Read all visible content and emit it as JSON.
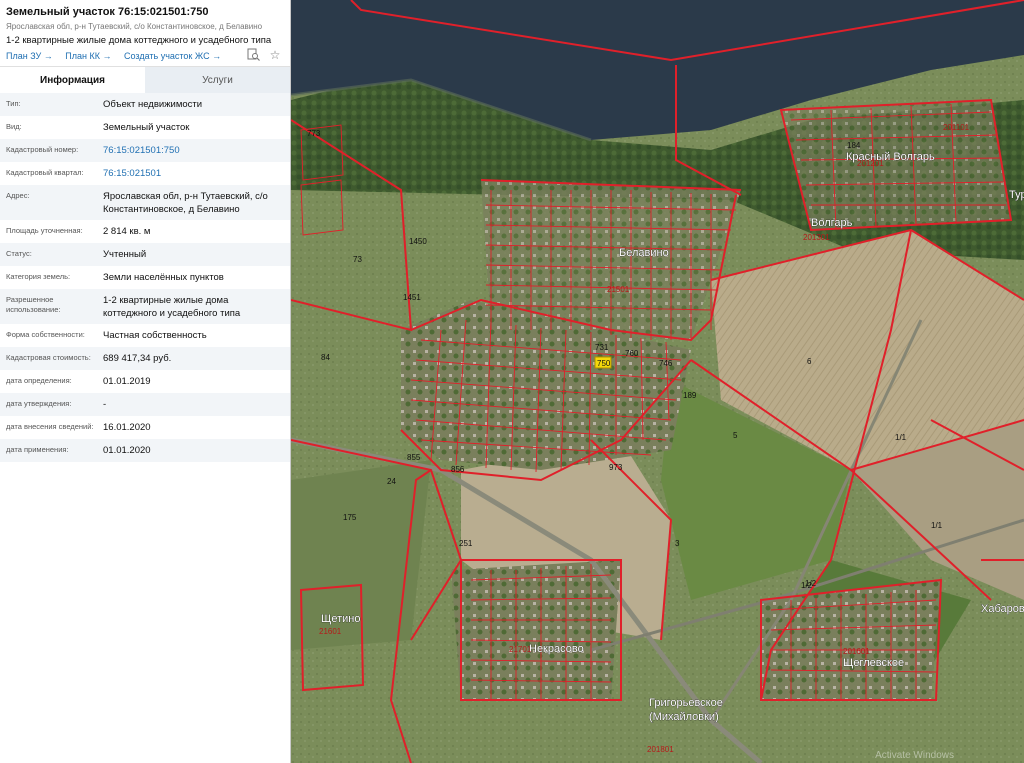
{
  "header": {
    "title": "Земельный участок 76:15:021501:750",
    "address_short": "Ярославская обл, р-н Тутаевский, с/о Константиновское, д Белавино",
    "permitted_use": "1-2 квартирные жилые дома коттеджного и усадебного типа",
    "links": [
      "План ЗУ",
      "План КК",
      "Создать участок ЖС"
    ],
    "tool_icons": [
      "search-doc-icon",
      "star-icon"
    ]
  },
  "tabs": [
    {
      "label": "Информация",
      "active": true
    },
    {
      "label": "Услуги",
      "active": false
    }
  ],
  "rows": [
    {
      "key": "Тип:",
      "value": "Объект недвижимости",
      "link": false
    },
    {
      "key": "Вид:",
      "value": "Земельный участок",
      "link": false
    },
    {
      "key": "Кадастровый номер:",
      "value": "76:15:021501:750",
      "link": true
    },
    {
      "key": "Кадастровый квартал:",
      "value": "76:15:021501",
      "link": true
    },
    {
      "key": "Адрес:",
      "value": "Ярославская обл, р-н Тутаевский, с/о Константиновское, д Белавино",
      "link": false
    },
    {
      "key": "Площадь уточненная:",
      "value": "2 814 кв. м",
      "link": false
    },
    {
      "key": "Статус:",
      "value": "Учтенный",
      "link": false
    },
    {
      "key": "Категория земель:",
      "value": "Земли населённых пунктов",
      "link": false
    },
    {
      "key": "Разрешенное использование:",
      "value": "1-2 квартирные жилые дома коттеджного и усадебного типа",
      "link": false
    },
    {
      "key": "Форма собственности:",
      "value": "Частная собственность",
      "link": false
    },
    {
      "key": "Кадастровая стоимость:",
      "value": "689 417,34 руб.",
      "link": false
    },
    {
      "key": "дата определения:",
      "value": "01.01.2019",
      "link": false
    },
    {
      "key": "дата утверждения:",
      "value": "-",
      "link": false
    },
    {
      "key": "дата внесения сведений:",
      "value": "16.01.2020",
      "link": false
    },
    {
      "key": "дата применения:",
      "value": "01.01.2020",
      "link": false
    }
  ],
  "map": {
    "places": [
      "Красный Волгарь",
      "Волгарь",
      "Белавино",
      "Щетино",
      "Некрасово",
      "Щеглевское",
      "Хабарово",
      "Григорьевское",
      "(Михайловки)",
      "Тур"
    ],
    "parcels": [
      "750",
      "773",
      "1450",
      "1451",
      "73",
      "84",
      "175",
      "5",
      "3",
      "6",
      "1/1",
      "1/2",
      "1/1",
      "189",
      "746",
      "760",
      "731",
      "973",
      "856",
      "855",
      "251",
      "24",
      "184",
      "1/2"
    ],
    "quarters": [
      "201201",
      "201101",
      "201301",
      "21501",
      "21601",
      "201801",
      "201601",
      "21701"
    ],
    "watermark": "Activate Windows",
    "colors": {
      "boundary": "#e0202a",
      "water": "#2b3a4a",
      "selected": "#f5d90a"
    }
  }
}
